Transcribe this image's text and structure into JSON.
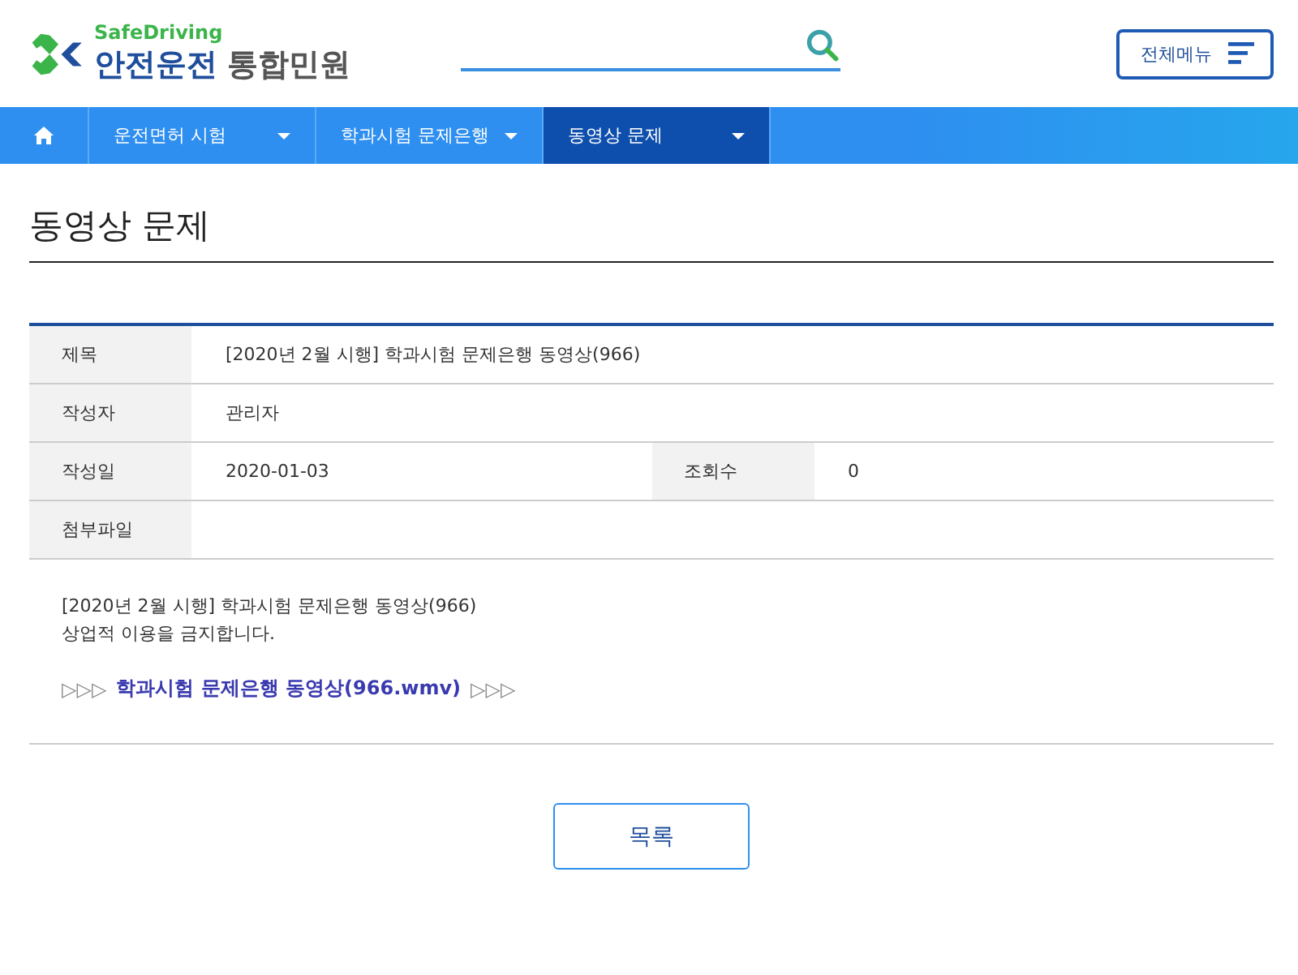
{
  "header": {
    "logo": {
      "brand": "SafeDriving",
      "title_main": "안전운전",
      "title_sub": "통합민원"
    },
    "all_menu_button": "전체메뉴"
  },
  "nav": {
    "items": [
      {
        "label": "운전면허 시험",
        "selected": false
      },
      {
        "label": "학과시험 문제은행",
        "selected": false
      },
      {
        "label": "동영상 문제",
        "selected": true
      }
    ]
  },
  "page_title": "동영상 문제",
  "details": [
    {
      "cells": [
        {
          "label": "제목",
          "value": "[2020년 2월 시행] 학과시험 문제은행 동영상(966)"
        }
      ]
    },
    {
      "cells": [
        {
          "label": "작성자",
          "value": "관리자"
        }
      ]
    },
    {
      "cells": [
        {
          "label": "작성일",
          "value": "2020-01-03"
        },
        {
          "label": "조회수",
          "value": "0"
        }
      ]
    },
    {
      "cells": [
        {
          "label": "첨부파일"
        }
      ]
    }
  ],
  "body": {
    "lines": [
      "[2020년 2월 시행] 학과시험 문제은행 동영상(966)",
      "상업적 이용을 금지합니다."
    ],
    "link_prefix": "▷▷▷",
    "link": "학과시험 문제은행 동영상(966.wmv)",
    "link_suffix": "▷▷▷"
  },
  "list_button": "목록"
}
